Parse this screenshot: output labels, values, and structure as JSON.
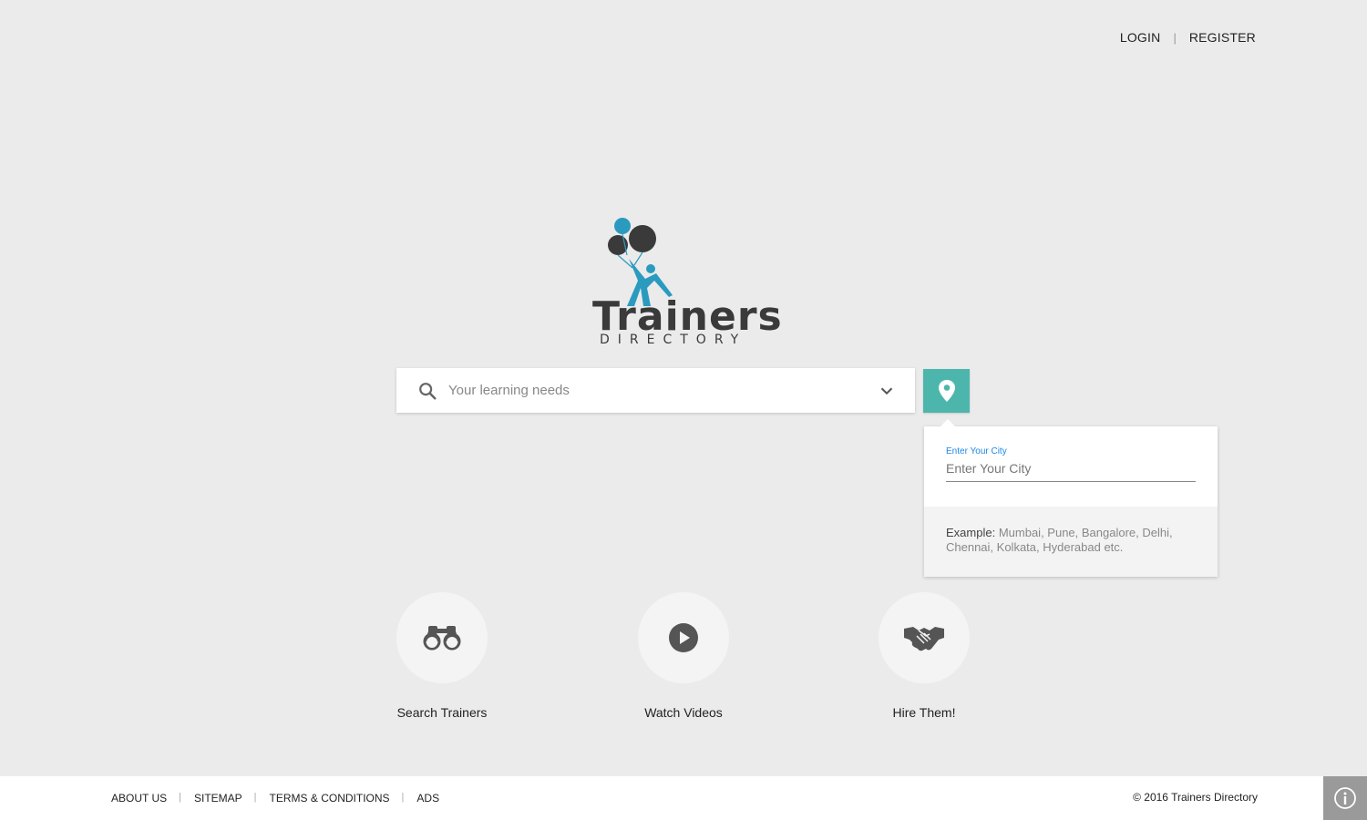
{
  "header": {
    "login_label": "LOGIN",
    "separator": "|",
    "register_label": "REGISTER"
  },
  "logo": {
    "word": "Trainers",
    "subtitle": "DIRECTORY",
    "colors": {
      "teal": "#2a9bbf",
      "dark": "#3a3a3a"
    }
  },
  "search": {
    "placeholder": "Your learning needs",
    "icon": "search-icon",
    "dropdown_icon": "chevron-down-icon"
  },
  "location_button": {
    "icon": "map-pin-icon",
    "color": "#4db6ac"
  },
  "city_popup": {
    "label": "Enter Your City",
    "placeholder": "Enter Your City",
    "example_label": "Example:",
    "example_text": "Mumbai, Pune, Bangalore, Delhi, Chennai, Kolkata, Hyderabad etc."
  },
  "features": [
    {
      "label": "Search Trainers",
      "icon": "binoculars-icon"
    },
    {
      "label": "Watch Videos",
      "icon": "play-icon"
    },
    {
      "label": "Hire Them!",
      "icon": "handshake-icon"
    }
  ],
  "footer": {
    "links": [
      "ABOUT US",
      "SITEMAP",
      "TERMS & CONDITIONS",
      "ADS"
    ],
    "separator": "|",
    "copyright": "© 2016 Trainers Directory",
    "info_icon": "info-icon"
  }
}
